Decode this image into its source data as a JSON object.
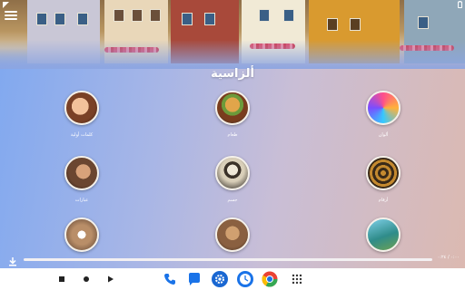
{
  "status_bar": {
    "icons": [
      "notification-icon",
      "battery-icon"
    ]
  },
  "header": {
    "menu_icon": "hamburger-menu-icon",
    "title": "ألزاسية"
  },
  "categories": [
    {
      "label": "كلمات أولية",
      "icon": "child-face-image"
    },
    {
      "label": "طعام",
      "icon": "burger-image"
    },
    {
      "label": "ألوان",
      "icon": "colorful-swirl-image"
    },
    {
      "label": "عبارات",
      "icon": "speaking-person-image"
    },
    {
      "label": "جسم",
      "icon": "skeleton-image"
    },
    {
      "label": "أرقام",
      "icon": "numbers-image"
    },
    {
      "label": "",
      "icon": "owl-image"
    },
    {
      "label": "",
      "icon": "robot-image"
    },
    {
      "label": "",
      "icon": "nature-image"
    }
  ],
  "player": {
    "progress": 0,
    "time_text": "٠:٠٠ / ٠:٢٤"
  },
  "nav": {
    "buttons": [
      "stop-icon",
      "home-icon",
      "back-icon"
    ]
  },
  "dock": {
    "apps": [
      "phone-icon",
      "messages-icon",
      "settings-icon",
      "clock-icon",
      "chrome-icon",
      "app-grid-icon"
    ]
  },
  "colors": {
    "accent_white": "#ffffff",
    "background_left": "#7fa8f0",
    "background_right": "#dcb9b0",
    "phone_blue": "#1a73e8",
    "settings_blue": "#1967d2",
    "chrome_red": "#ea4335",
    "chrome_yellow": "#fbbc05",
    "chrome_green": "#34a853"
  }
}
